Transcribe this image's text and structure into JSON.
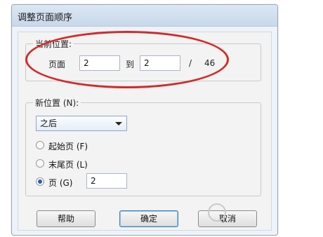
{
  "dialog": {
    "title": "调整页面顺序"
  },
  "current_position": {
    "label": "当前位置:",
    "pages_label": "页面",
    "from_value": "2",
    "to_label": "到",
    "to_value": "2",
    "separator": "/",
    "total": "46"
  },
  "new_position": {
    "label": "新位置 (N):",
    "select_value": "之后",
    "options": [
      {
        "label": "起始页 (F)",
        "checked": false
      },
      {
        "label": "末尾页 (L)",
        "checked": false
      },
      {
        "label": "页 (G)",
        "checked": true
      }
    ],
    "page_value": "2"
  },
  "buttons": {
    "help": "帮助",
    "ok": "确定",
    "cancel": "取消"
  },
  "annotation": {
    "color": "#d32a2a"
  }
}
